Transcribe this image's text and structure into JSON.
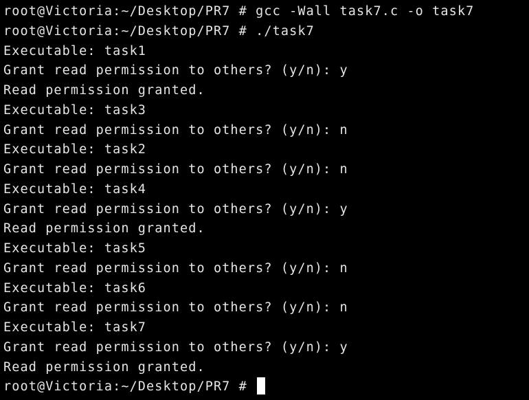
{
  "terminal": {
    "lines": [
      "root@Victoria:~/Desktop/PR7 # gcc -Wall task7.c -o task7",
      "root@Victoria:~/Desktop/PR7 # ./task7",
      "Executable: task1",
      "Grant read permission to others? (y/n): y",
      "Read permission granted.",
      "Executable: task3",
      "Grant read permission to others? (y/n): n",
      "Executable: task2",
      "Grant read permission to others? (y/n): n",
      "Executable: task4",
      "Grant read permission to others? (y/n): y",
      "Read permission granted.",
      "Executable: task5",
      "Grant read permission to others? (y/n): n",
      "Executable: task6",
      "Grant read permission to others? (y/n): n",
      "Executable: task7",
      "Grant read permission to others? (y/n): y",
      "Read permission granted."
    ],
    "prompt": "root@Victoria:~/Desktop/PR7 # "
  },
  "colors": {
    "background": "#000000",
    "foreground": "#e6e6e6",
    "cursor": "#ffffff"
  }
}
